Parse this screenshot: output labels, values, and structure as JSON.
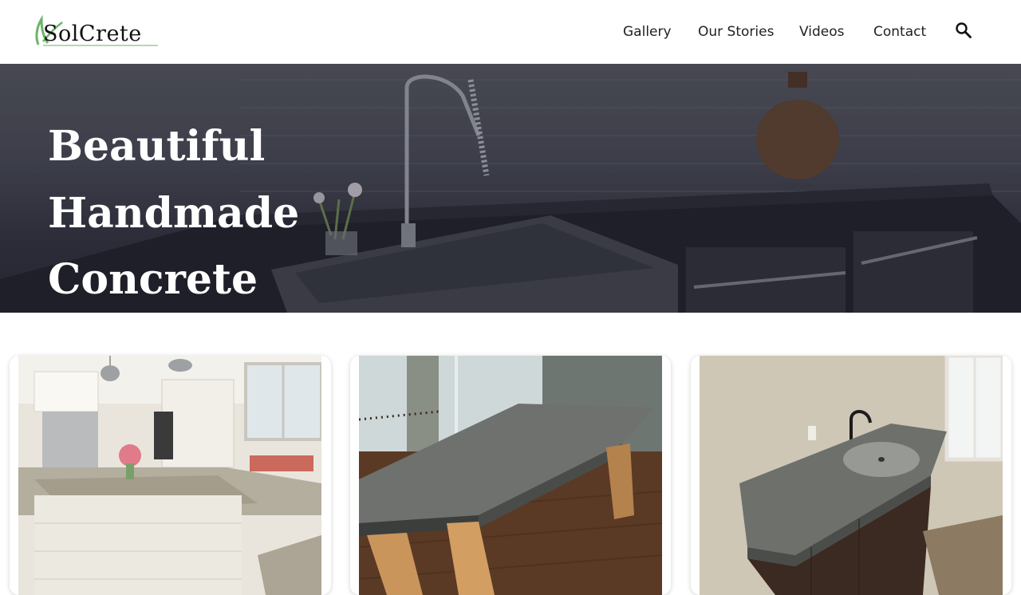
{
  "header": {
    "logo_text": "SolCrete",
    "logo_icon": "leaf-swoosh-icon",
    "nav": [
      {
        "label": "Gallery"
      },
      {
        "label": "Our Stories"
      },
      {
        "label": "Videos"
      },
      {
        "label": "Contact"
      }
    ],
    "search_icon": "search-icon"
  },
  "hero": {
    "title_lines": [
      "Beautiful",
      "Handmade",
      "Concrete"
    ]
  },
  "cards": [
    {
      "image": "concrete kitchen island photo"
    },
    {
      "image": "concrete table photo"
    },
    {
      "image": "concrete vanity sink photo"
    }
  ],
  "colors": {
    "accent_green": "#6db36a",
    "hero_overlay": "#1c1e2d",
    "text": "#222222"
  }
}
